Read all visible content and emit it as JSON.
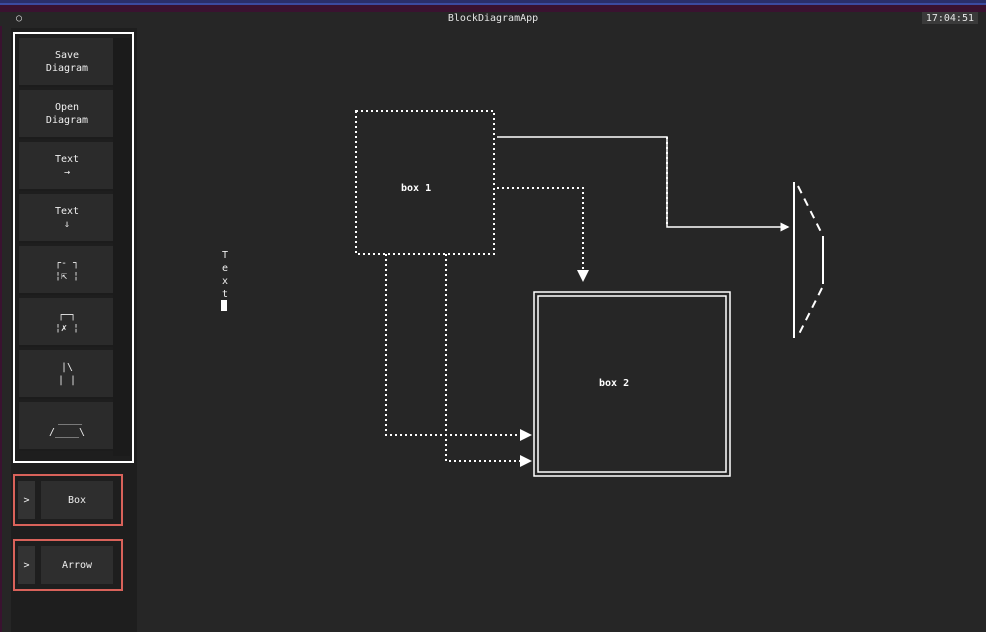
{
  "app": {
    "title": "BlockDiagramApp",
    "clock": "17:04:51",
    "title_icon": "○"
  },
  "toolbox": {
    "buttons": [
      {
        "label": "Save\nDiagram"
      },
      {
        "label": "Open\nDiagram"
      },
      {
        "label": "Text\n→"
      },
      {
        "label": "Text\n⇓"
      },
      {
        "label": "┌- ┐\n¦⇱ ¦"
      },
      {
        "label": "┌─┐\n¦✗ ¦"
      },
      {
        "label": "|\\\n| |"
      },
      {
        "label": " ____\n/____\\"
      }
    ]
  },
  "groups": [
    {
      "expander": ">",
      "label": "Box"
    },
    {
      "expander": ">",
      "label": "Arrow"
    }
  ],
  "canvas": {
    "vertical_text": "Text",
    "box1_label": "box 1",
    "box2_label": "box 2"
  }
}
